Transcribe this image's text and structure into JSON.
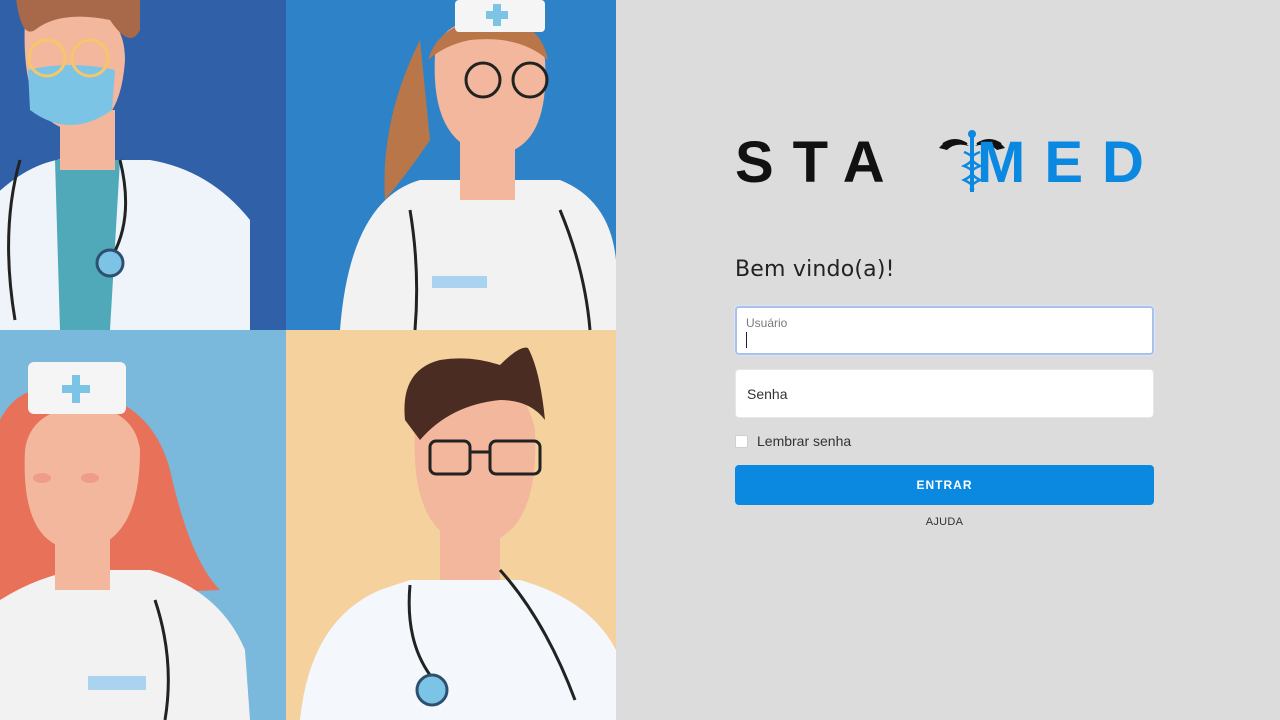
{
  "brand": {
    "prefix": "STA",
    "suffix": "MED",
    "prefix_color": "#111111",
    "suffix_color": "#0b88df",
    "emblem_icon": "caduceus-icon"
  },
  "login": {
    "welcome": "Bem vindo(a)!",
    "username_label": "Usuário",
    "username_value": "",
    "password_placeholder": "Senha",
    "remember_label": "Lembrar senha",
    "remember_checked": false,
    "submit_label": "ENTRAR",
    "help_label": "AJUDA"
  },
  "colors": {
    "accent": "#0b88df",
    "panel_bg": "#dcdcdc"
  }
}
